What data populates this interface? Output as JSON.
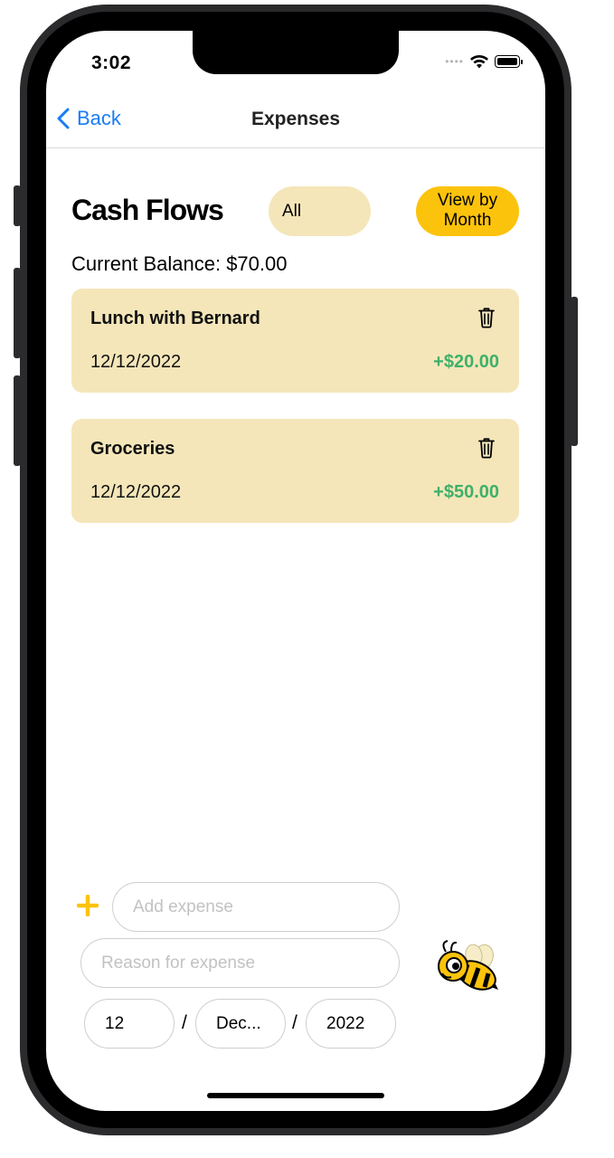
{
  "status_bar": {
    "time": "3:02"
  },
  "nav": {
    "back_label": "Back",
    "title": "Expenses"
  },
  "header": {
    "title": "Cash Flows",
    "filter_label": "All",
    "view_by_month_label": "View by Month"
  },
  "balance": {
    "text": "Current Balance: $70.00"
  },
  "expenses": [
    {
      "title": "Lunch with Bernard",
      "date": "12/12/2022",
      "amount": "+$20.00"
    },
    {
      "title": "Groceries",
      "date": "12/12/2022",
      "amount": "+$50.00"
    }
  ],
  "form": {
    "add_expense_placeholder": "Add expense",
    "reason_placeholder": "Reason for expense",
    "day_value": "12",
    "month_value": "Dec...",
    "year_value": "2022",
    "separator": "/"
  },
  "colors": {
    "accent_yellow": "#fcc30d",
    "card_background": "#f4e6b9",
    "positive_amount": "#3fb06a",
    "link_blue": "#1a7cf5"
  },
  "icons": [
    "chevron-left-icon",
    "trash-icon",
    "plus-icon",
    "bee-mascot-icon",
    "wifi-icon",
    "battery-icon"
  ]
}
